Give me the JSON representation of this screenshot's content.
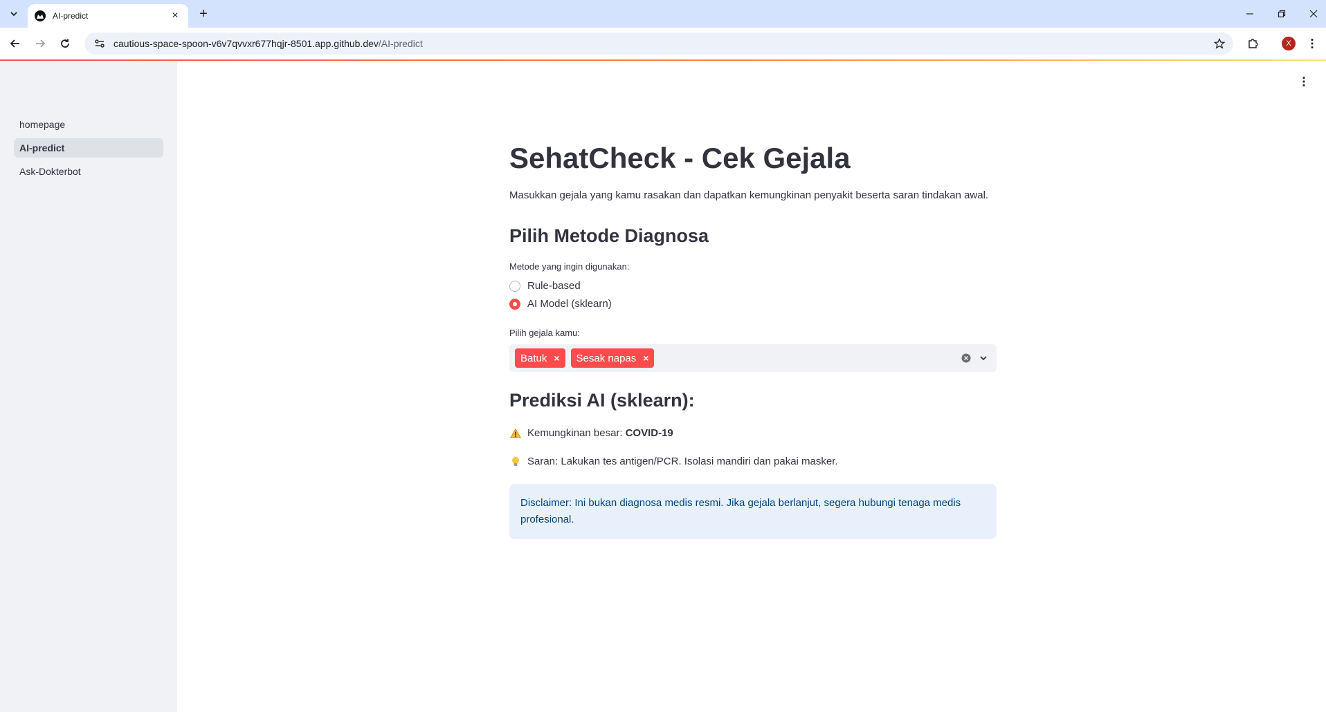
{
  "browser": {
    "tab_title": "AI-predict",
    "url_host": "cautious-space-spoon-v6v7qvvxr677hqjr-8501.app.github.dev",
    "url_path": "/AI-predict",
    "avatar_letter": "X"
  },
  "sidebar": {
    "items": [
      {
        "label": "homepage"
      },
      {
        "label": "AI-predict"
      },
      {
        "label": "Ask-Dokterbot"
      }
    ]
  },
  "main": {
    "title": "SehatCheck - Cek Gejala",
    "intro": "Masukkan gejala yang kamu rasakan dan dapatkan kemungkinan penyakit beserta saran tindakan awal.",
    "method_heading": "Pilih Metode Diagnosa",
    "method_label": "Metode yang ingin digunakan:",
    "methods": [
      {
        "label": "Rule-based",
        "selected": false
      },
      {
        "label": "AI Model (sklearn)",
        "selected": true
      }
    ],
    "symptom_label": "Pilih gejala kamu:",
    "symptoms": [
      {
        "label": "Batuk"
      },
      {
        "label": "Sesak napas"
      }
    ],
    "prediction_heading": "Prediksi AI (sklearn):",
    "prediction_prefix": "Kemungkinan besar:",
    "prediction_value": "COVID-19",
    "suggestion": "Saran: Lakukan tes antigen/PCR. Isolasi mandiri dan pakai masker.",
    "disclaimer": "Disclaimer: Ini bukan diagnosa medis resmi. Jika gejala berlanjut, segera hubungi tenaga medis profesional."
  },
  "colors": {
    "accent": "#ff4b4b",
    "sidebar_bg": "#f0f2f6",
    "info_bg": "#e8f1fb",
    "info_text": "#004280"
  }
}
